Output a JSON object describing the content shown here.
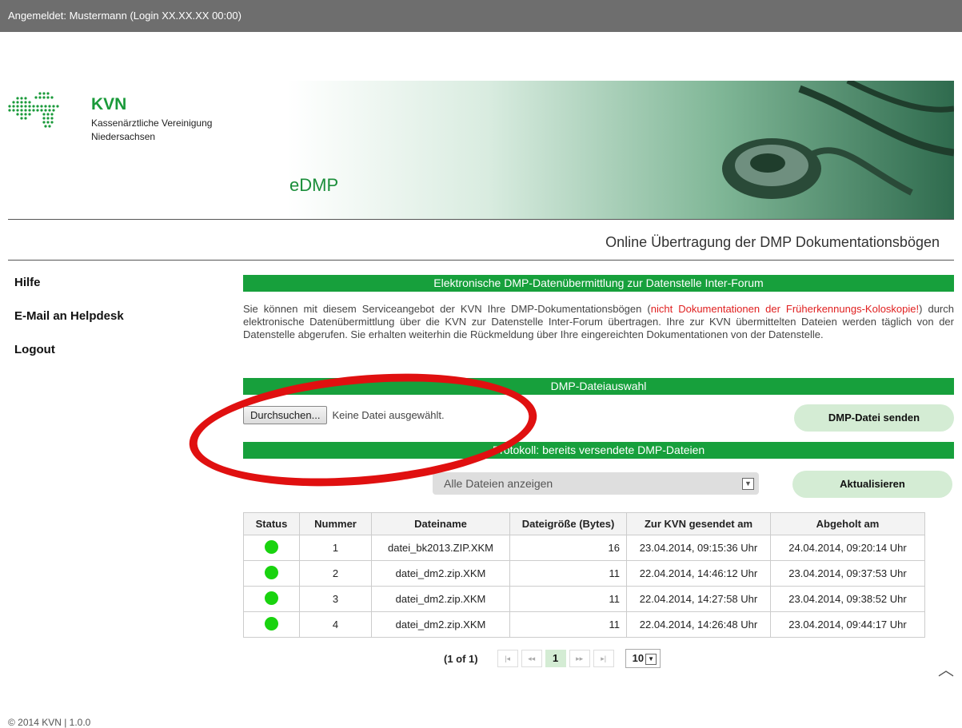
{
  "topbar": {
    "login_text": "Angemeldet: Mustermann (Login XX.XX.XX 00:00)"
  },
  "header": {
    "logo_abbr": "KVN",
    "logo_line1": "Kassenärztliche Vereinigung",
    "logo_line2": "Niedersachsen",
    "app_name": "eDMP",
    "subtitle": "Online Übertragung der DMP Dokumentationsbögen"
  },
  "nav": {
    "items": [
      "Hilfe",
      "E-Mail an Helpdesk",
      "Logout"
    ]
  },
  "section1": {
    "title": "Elektronische DMP-Datenübermittlung zur Datenstelle Inter-Forum",
    "text_before": "Sie können mit diesem Serviceangebot der KVN Ihre DMP-Dokumentationsbögen (",
    "text_red": "nicht Dokumentationen der Früherkennungs-Koloskopie!",
    "text_after": ") durch elektronische Datenübermittlung über die KVN zur Datenstelle Inter-Forum übertragen. Ihre zur KVN übermittelten Dateien werden täglich von der Datenstelle abgerufen. Sie erhalten weiterhin die Rückmeldung über Ihre eingereichten Dokumentationen von der Datenstelle."
  },
  "section2": {
    "title": "DMP-Dateiauswahl",
    "browse_label": "Durchsuchen...",
    "no_file_text": "Keine Datei ausgewählt.",
    "send_label": "DMP-Datei senden"
  },
  "section3": {
    "title": "Protokoll: bereits versendete DMP-Dateien",
    "filter_value": "Alle Dateien anzeigen",
    "refresh_label": "Aktualisieren"
  },
  "table": {
    "headers": [
      "Status",
      "Nummer",
      "Dateiname",
      "Dateigröße (Bytes)",
      "Zur KVN gesendet am",
      "Abgeholt am"
    ],
    "rows": [
      {
        "status": "green",
        "nummer": "1",
        "name": "datei_bk2013.ZIP.XKM",
        "size": "16",
        "sent": "23.04.2014, 09:15:36 Uhr",
        "fetched": "24.04.2014, 09:20:14 Uhr"
      },
      {
        "status": "green",
        "nummer": "2",
        "name": "datei_dm2.zip.XKM",
        "size": "11",
        "sent": "22.04.2014, 14:46:12 Uhr",
        "fetched": "23.04.2014, 09:37:53 Uhr"
      },
      {
        "status": "green",
        "nummer": "3",
        "name": "datei_dm2.zip.XKM",
        "size": "11",
        "sent": "22.04.2014, 14:27:58 Uhr",
        "fetched": "23.04.2014, 09:38:52 Uhr"
      },
      {
        "status": "green",
        "nummer": "4",
        "name": "datei_dm2.zip.XKM",
        "size": "11",
        "sent": "22.04.2014, 14:26:48 Uhr",
        "fetched": "23.04.2014, 09:44:17 Uhr"
      }
    ]
  },
  "pager": {
    "summary": "(1 of 1)",
    "first": "|◂",
    "prev": "◂◂",
    "current": "1",
    "next": "▸▸",
    "last": "▸|",
    "rows_per_page": "10"
  },
  "footer": {
    "text": "© 2014 KVN | 1.0.0"
  },
  "colors": {
    "green": "#17a03c",
    "status_ok": "#19d30f",
    "pill": "#d4ecd4",
    "annotation": "#e01010"
  },
  "icons": {
    "scroll_top": "chevron-up-icon",
    "dropdown": "chevron-down-icon"
  }
}
